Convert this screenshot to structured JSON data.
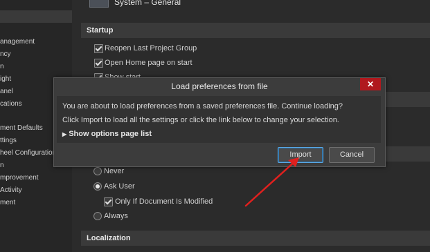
{
  "sidebar": {
    "items": [
      {
        "label": "anagement"
      },
      {
        "label": "ncy"
      },
      {
        "label": "n"
      },
      {
        "label": "ight"
      },
      {
        "label": "anel"
      },
      {
        "label": "cations"
      },
      {
        "label": "ment Defaults"
      },
      {
        "label": "ttings"
      },
      {
        "label": "heel Configuration"
      },
      {
        "label": "n"
      },
      {
        "label": "mprovement"
      },
      {
        "label": "Activity"
      },
      {
        "label": "ment"
      }
    ]
  },
  "header": {
    "title": "System – General",
    "icon": "system-general-icon"
  },
  "startup": {
    "title": "Startup",
    "options": [
      {
        "label": "Reopen Last Project Group",
        "checked": true
      },
      {
        "label": "Open Home page on start",
        "checked": true
      },
      {
        "label": "Show start...",
        "checked": true
      }
    ]
  },
  "reload": {
    "options": [
      {
        "label": "Never",
        "selected": false
      },
      {
        "label": "Ask User",
        "selected": true
      },
      {
        "label": "Only If Document Is Modified",
        "checked": true
      },
      {
        "label": "Always",
        "selected": false
      }
    ]
  },
  "localization": {
    "title": "Localization"
  },
  "dialog": {
    "title": "Load preferences from file",
    "close": "✕",
    "message1": "You are about to load preferences from a saved preferences file. Continue loading?",
    "message2": "Click Import to load all the settings or click the link below to change your selection.",
    "toggle": "Show options page list",
    "import_label": "Import",
    "cancel_label": "Cancel"
  },
  "colors": {
    "accent": "#5aa9e6",
    "close": "#b0191e",
    "arrow": "#e0201e"
  }
}
